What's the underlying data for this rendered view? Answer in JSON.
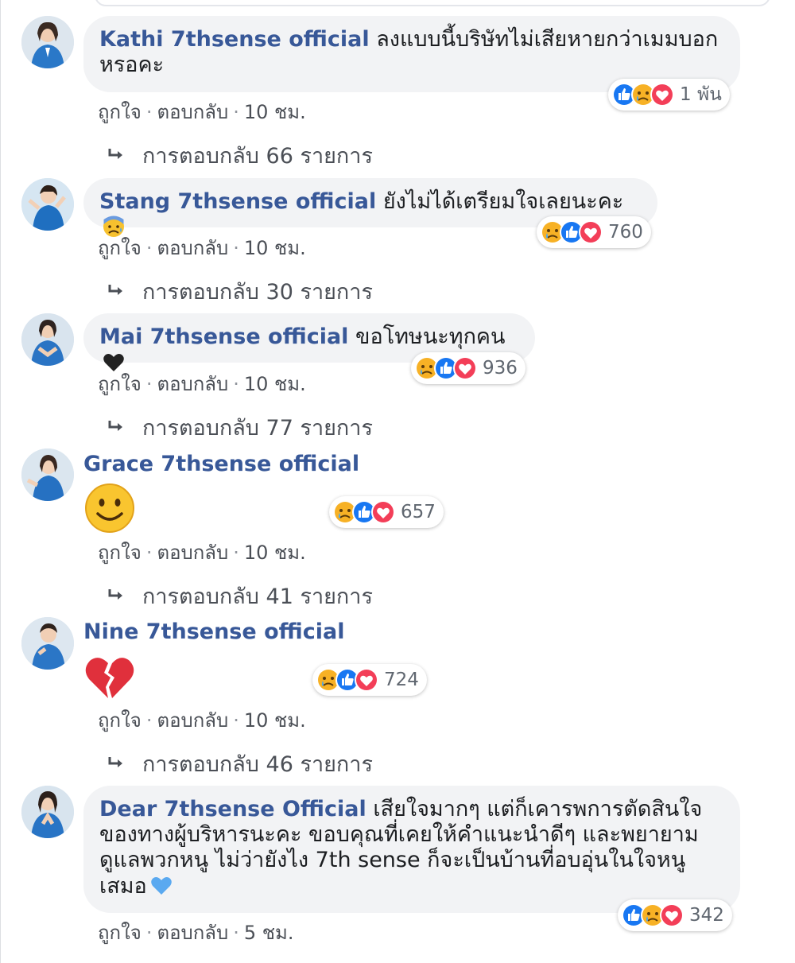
{
  "colors": {
    "author": "#385898",
    "bubble": "#f2f3f5",
    "like": "#1877f2",
    "love": "#f33e58",
    "sad": "#f7b125",
    "meta_text": "#4b4f56"
  },
  "icons": {
    "reply": "reply-arrow-icon",
    "like": "like-reaction-icon",
    "sad": "sad-reaction-icon",
    "love": "love-reaction-icon"
  },
  "actions": {
    "like": "ถูกใจ",
    "reply": "ตอบกลับ",
    "sep": "·"
  },
  "comments": [
    {
      "author": "Kathi 7thsense official",
      "text": "ลงแบบนี้บริษัทไม่เสียหายกว่าเมมบอกหรอคะ",
      "time": "10 ชม.",
      "reaction_order": [
        "like",
        "sad",
        "love"
      ],
      "reaction_count": "1 พัน",
      "replies": "การตอบกลับ 66 รายการ"
    },
    {
      "author": "Stang 7thsense official",
      "text": "ยังไม่ได้เตรียมใจเลยนะคะ",
      "text_emoji": "anxious-face-emoji",
      "time": "10 ชม.",
      "reaction_order": [
        "sad",
        "like",
        "love"
      ],
      "reaction_count": "760",
      "replies": "การตอบกลับ 30 รายการ"
    },
    {
      "author": "Mai 7thsense official",
      "text": "ขอโทษนะทุกคน",
      "text_emoji": "black-heart-emoji",
      "time": "10 ชม.",
      "reaction_order": [
        "sad",
        "like",
        "love"
      ],
      "reaction_count": "936",
      "replies": "การตอบกลับ 77 รายการ"
    },
    {
      "author": "Grace 7thsense official",
      "text": "",
      "emoji": "smiling-face-emoji",
      "time": "10 ชม.",
      "reaction_order": [
        "sad",
        "like",
        "love"
      ],
      "reaction_count": "657",
      "replies": "การตอบกลับ 41 รายการ"
    },
    {
      "author": "Nine 7thsense official",
      "text": "",
      "emoji": "broken-heart-emoji",
      "time": "10 ชม.",
      "reaction_order": [
        "sad",
        "like",
        "love"
      ],
      "reaction_count": "724",
      "replies": "การตอบกลับ 46 รายการ"
    },
    {
      "author": "Dear 7thsense Official",
      "text": "เสียใจมากๆ แต่ก็เคารพการตัดสินใจของทางผู้บริหารนะคะ ขอบคุณที่เคยให้คำแนะนำดีๆ และพยายามดูแลพวกหนู ไม่ว่ายังไง 7th sense ก็จะเป็นบ้านที่อบอุ่นในใจหนูเสมอ",
      "text_emoji": "blue-heart-emoji",
      "time": "5 ชม.",
      "reaction_order": [
        "like",
        "sad",
        "love"
      ],
      "reaction_count": "342"
    }
  ]
}
